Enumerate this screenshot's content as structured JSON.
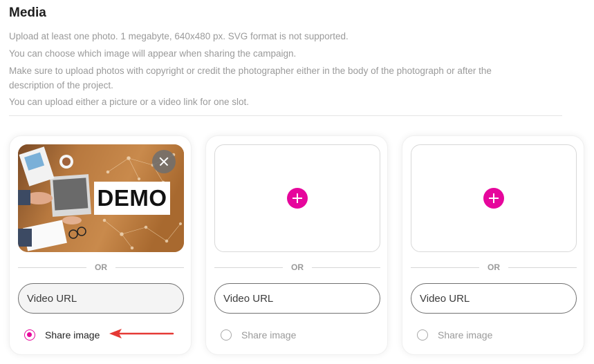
{
  "header": {
    "title": "Media",
    "description": [
      "Upload at least one photo. 1 megabyte, 640x480 px. SVG format is not supported.",
      "You can choose which image will appear when sharing the campaign.",
      "Make sure to upload photos with copyright or credit the photographer either in the body of the photograph or after the",
      "description of the project.",
      "You can upload either a picture or a video link for one slot."
    ]
  },
  "slots": [
    {
      "image_text": "DEMO",
      "or_label": "OR",
      "video_placeholder": "Video URL",
      "share_label": "Share image",
      "share_selected": true
    },
    {
      "or_label": "OR",
      "video_placeholder": "Video URL",
      "share_label": "Share image",
      "share_selected": false
    },
    {
      "or_label": "OR",
      "video_placeholder": "Video URL",
      "share_label": "Share image",
      "share_selected": false
    }
  ],
  "colors": {
    "accent": "#e6069c",
    "arrow": "#e53935",
    "muted_text": "#9a9a9a"
  },
  "icons": {
    "add": "plus-icon",
    "remove": "close-icon",
    "pointer": "arrow-left-icon"
  }
}
